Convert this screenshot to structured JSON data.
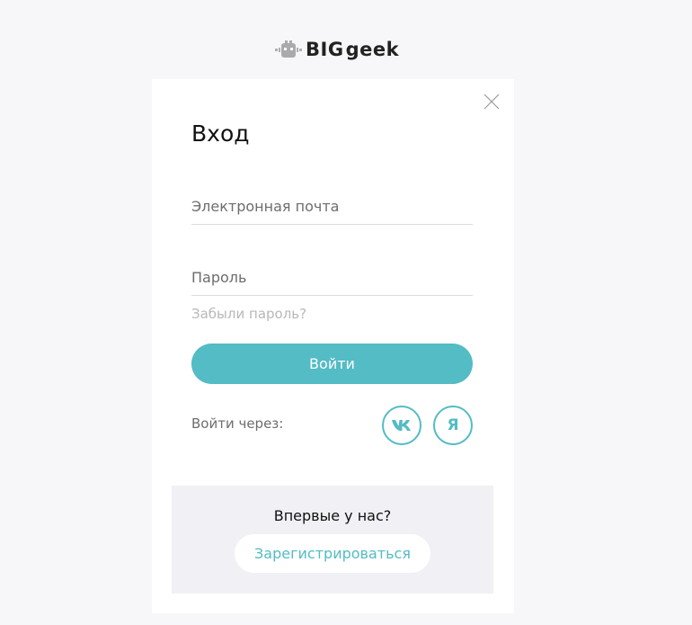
{
  "brand": {
    "logo_big": "BIG",
    "logo_geek": "geek",
    "accent_color": "#53bcc4"
  },
  "login": {
    "title": "Вход",
    "close_icon": "close-icon",
    "email_placeholder": "Электронная почта",
    "email_value": "",
    "password_placeholder": "Пароль",
    "password_value": "",
    "forgot_link": "Забыли пароль?",
    "submit_label": "Войти",
    "social_label": "Войти через:",
    "social": [
      {
        "name": "vk",
        "icon": "vk-icon"
      },
      {
        "name": "yandex",
        "icon": "yandex-icon",
        "glyph": "Я"
      }
    ]
  },
  "register": {
    "question": "Впервые у нас?",
    "button_label": "Зарегистрироваться"
  }
}
